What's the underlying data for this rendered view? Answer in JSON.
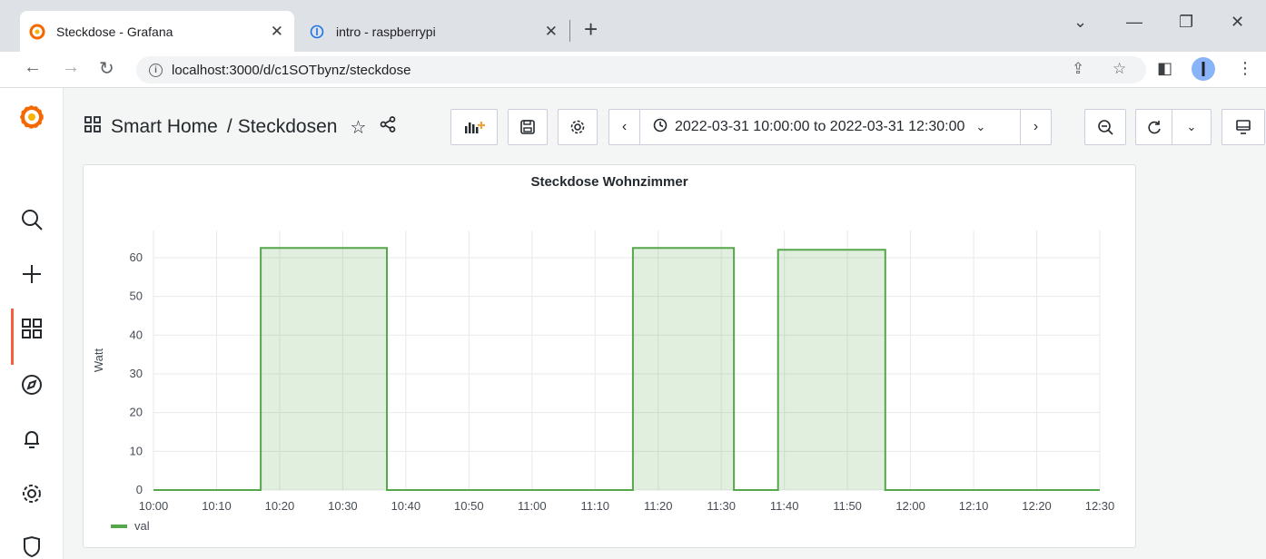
{
  "browser": {
    "tabs": [
      {
        "title": "Steckdose - Grafana",
        "active": true,
        "icon": "grafana-icon"
      },
      {
        "title": "intro - raspberrypi",
        "active": false,
        "icon": "info-circle-icon"
      }
    ],
    "url": "localhost:3000/d/c1SOTbynz/steckdose"
  },
  "sidemenu": {
    "items": [
      "grafana-logo",
      "search-icon",
      "plus-icon",
      "dashboards-icon",
      "explore-icon",
      "alerting-icon",
      "settings-icon",
      "shield-icon"
    ],
    "active": "dashboards-icon"
  },
  "dashboard": {
    "breadcrumb_folder": "Smart Home",
    "separator": "/",
    "title": "Steckdosen",
    "time_range": "2022-03-31 10:00:00 to 2022-03-31 12:30:00"
  },
  "panel": {
    "title": "Steckdose Wohnzimmer"
  },
  "chart_data": {
    "type": "area",
    "title": "Steckdose Wohnzimmer",
    "xlabel": "",
    "ylabel": "Watt",
    "x_ticks": [
      "10:00",
      "10:10",
      "10:20",
      "10:30",
      "10:40",
      "10:50",
      "11:00",
      "11:10",
      "11:20",
      "11:30",
      "11:40",
      "11:50",
      "12:00",
      "12:10",
      "12:20",
      "12:30"
    ],
    "y_ticks": [
      0,
      10,
      20,
      30,
      40,
      50,
      60
    ],
    "xlim": [
      "10:00",
      "12:30"
    ],
    "ylim": [
      0,
      67
    ],
    "step": true,
    "grid": true,
    "legend_position": "bottom-left",
    "color": "#56a64b",
    "series": [
      {
        "name": "val",
        "points": [
          {
            "x": "10:00",
            "y": 0
          },
          {
            "x": "10:17",
            "y": 0
          },
          {
            "x": "10:17",
            "y": 62.5
          },
          {
            "x": "10:37",
            "y": 62.5
          },
          {
            "x": "10:37",
            "y": 0
          },
          {
            "x": "11:16",
            "y": 0
          },
          {
            "x": "11:16",
            "y": 62.5
          },
          {
            "x": "11:32",
            "y": 62.5
          },
          {
            "x": "11:32",
            "y": 0
          },
          {
            "x": "11:39",
            "y": 0
          },
          {
            "x": "11:39",
            "y": 62
          },
          {
            "x": "11:56",
            "y": 62
          },
          {
            "x": "11:56",
            "y": 0
          },
          {
            "x": "12:30",
            "y": 0
          }
        ]
      }
    ]
  }
}
